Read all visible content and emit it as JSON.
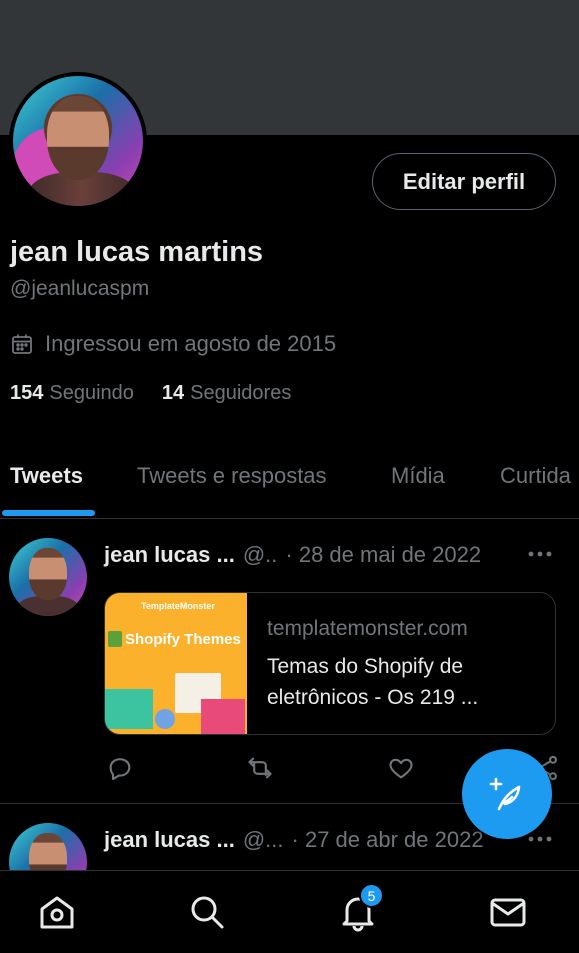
{
  "profile": {
    "display_name": "jean lucas martins",
    "handle": "@jeanlucaspm",
    "joined": "Ingressou em agosto de 2015",
    "following_count": "154",
    "following_label": "Seguindo",
    "followers_count": "14",
    "followers_label": "Seguidores",
    "edit_button": "Editar perfil"
  },
  "tabs": [
    {
      "label": "Tweets",
      "active": true
    },
    {
      "label": "Tweets e respostas",
      "active": false
    },
    {
      "label": "Mídia",
      "active": false
    },
    {
      "label": "Curtida",
      "active": false
    }
  ],
  "tweets": [
    {
      "name": "jean lucas ...",
      "handle": "@..",
      "date": "· 28 de mai de 2022",
      "card": {
        "brand": "TemplateMonster",
        "thumb_title": "Shopify Themes",
        "domain": "templatemonster.com",
        "title": "Temas do Shopify de eletrônicos - Os 219 ..."
      }
    },
    {
      "name": "jean lucas ...",
      "handle": "@...",
      "date": "· 27 de abr de 2022"
    }
  ],
  "notifications_badge": "5",
  "colors": {
    "accent": "#1d9bf0",
    "background": "#000000",
    "banner": "#333639",
    "secondary_text": "#71767b"
  },
  "icons": [
    "calendar-icon",
    "reply-icon",
    "retweet-icon",
    "like-icon",
    "share-icon",
    "compose-icon",
    "home-icon",
    "search-icon",
    "bell-icon",
    "mail-icon",
    "more-icon"
  ]
}
